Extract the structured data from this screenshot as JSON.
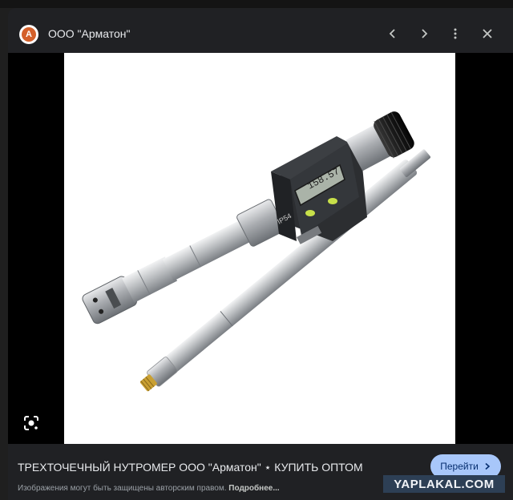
{
  "header": {
    "logo_letter": "A",
    "source_name": "ООО \"Арматон\"",
    "prev_icon": "chevron-left-icon",
    "next_icon": "chevron-right-icon",
    "more_icon": "more-vert-icon",
    "close_icon": "close-icon"
  },
  "photo": {
    "display_reading": "158.57",
    "head_label": "IP54"
  },
  "footer": {
    "title": "ТРЕХТОЧЕЧНЫЙ НУТРОМЕР ООО \"Арматон\" ⋆ КУПИТЬ ОПТОМ",
    "visit_label": "Перейти",
    "copyright_text": "Изображения могут быть защищены авторским правом.",
    "more_link": "Подробнее...",
    "watermark": "YAPLAKAL.COM"
  },
  "colors": {
    "accent_button": "#a8c7fa",
    "panel_bg": "#202124"
  }
}
